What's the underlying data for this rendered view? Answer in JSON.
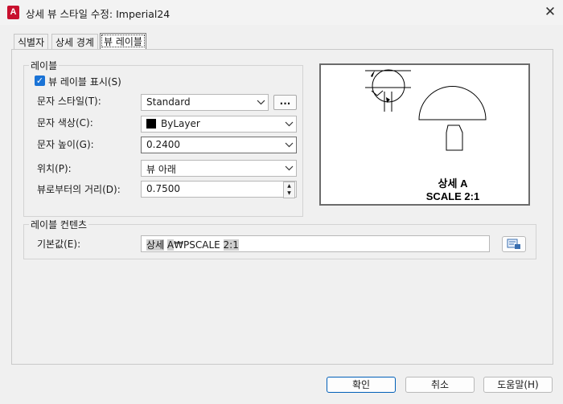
{
  "window": {
    "title": "상세 뷰 스타일 수정: Imperial24",
    "app_icon_letter": "A",
    "close_glyph": "✕",
    "accent_color": "#c8102e"
  },
  "tabs": [
    {
      "label": "식별자"
    },
    {
      "label": "상세 경계"
    },
    {
      "label": "뷰 레이블",
      "active": true
    }
  ],
  "label_group": {
    "title": "레이블",
    "show_label": {
      "label": "뷰 레이블 표시(S)",
      "checked": true
    },
    "text_style": {
      "label": "문자 스타일(T):",
      "value": "Standard",
      "browse": "..."
    },
    "text_color": {
      "label": "문자 색상(C):",
      "value": "ByLayer",
      "swatch": "#000000"
    },
    "text_height": {
      "label": "문자 높이(G):",
      "value": "0.2400"
    },
    "position": {
      "label": "위치(P):",
      "value": "뷰 아래"
    },
    "distance": {
      "label": "뷰로부터의 거리(D):",
      "value": "0.7500"
    }
  },
  "preview": {
    "caption_line1": "상세 A",
    "caption_line2": "SCALE 2:1"
  },
  "contents_group": {
    "title": "레이블 컨텐츠",
    "default_label": "기본값(E):",
    "default_parts": [
      {
        "text": "상세",
        "hl": true
      },
      {
        "text": " ",
        "hl": false
      },
      {
        "text": "A",
        "hl": true
      },
      {
        "text": "₩PSCALE ",
        "hl": false
      },
      {
        "text": "2:1",
        "hl": true
      }
    ]
  },
  "buttons": {
    "ok": "확인",
    "cancel": "취소",
    "help": "도움말(H)"
  }
}
